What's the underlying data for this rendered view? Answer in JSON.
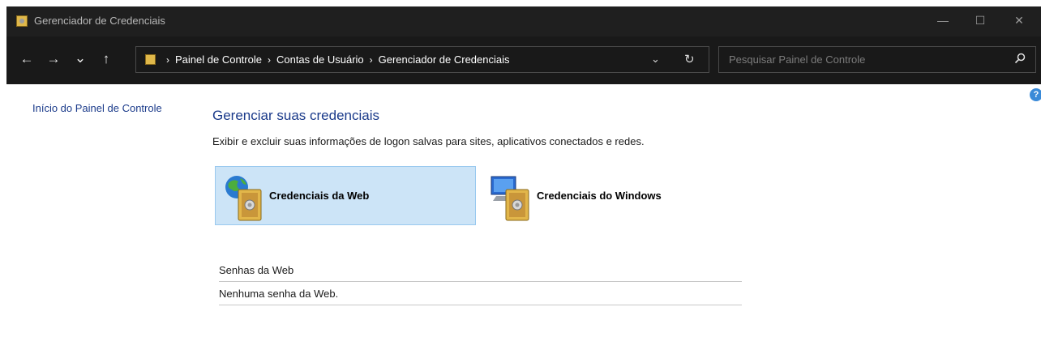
{
  "window": {
    "title": "Gerenciador de Credenciais",
    "controls": {
      "minimize": "—",
      "maximize": "☐",
      "close": "✕"
    }
  },
  "nav": {
    "back": "←",
    "forward": "→",
    "recent": "⌄",
    "up": "↑",
    "breadcrumb": [
      "Painel de Controle",
      "Contas de Usuário",
      "Gerenciador de Credenciais"
    ],
    "crumb_sep": "›",
    "dropdown": "⌄",
    "refresh": "↻",
    "search_placeholder": "Pesquisar Painel de Controle"
  },
  "sidebar": {
    "home_link": "Início do Painel de Controle"
  },
  "help": "?",
  "main": {
    "heading": "Gerenciar suas credenciais",
    "subtitle": "Exibir e excluir suas informações de logon salvas para sites, aplicativos conectados e redes.",
    "tiles": [
      {
        "label": "Credenciais da Web",
        "selected": true,
        "icon": "web-credentials-icon"
      },
      {
        "label": "Credenciais do Windows",
        "selected": false,
        "icon": "windows-credentials-icon"
      }
    ],
    "section_title": "Senhas da Web",
    "empty_message": "Nenhuma senha da Web."
  },
  "colors": {
    "titlebar": "#1f1f1f",
    "navbar": "#191919",
    "link": "#1a3a8a",
    "tile_selected_bg": "#cce4f7",
    "tile_selected_border": "#99c9ef"
  }
}
